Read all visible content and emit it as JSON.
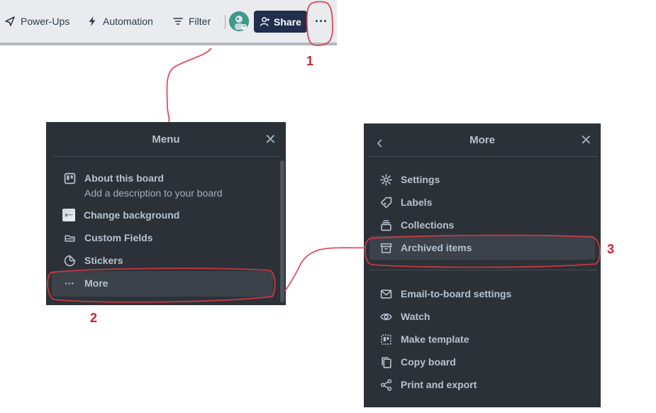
{
  "toolbar": {
    "power_ups": "Power-Ups",
    "automation": "Automation",
    "filter": "Filter",
    "share": "Share",
    "more": "···"
  },
  "menu_panel": {
    "title": "Menu",
    "close": "✕",
    "about": "About this board",
    "about_desc": "Add a description to your board",
    "change_background": "Change background",
    "background_thumb_text": "a—",
    "custom_fields": "Custom Fields",
    "stickers": "Stickers",
    "more": "More",
    "more_dots": "···"
  },
  "more_panel": {
    "title": "More",
    "back": "‹",
    "close": "✕",
    "items": [
      "Settings",
      "Labels",
      "Collections",
      "Archived items",
      "Email-to-board settings",
      "Watch",
      "Make template",
      "Copy board",
      "Print and export"
    ]
  },
  "annotations": {
    "step1": "1",
    "step2": "2",
    "step3": "3",
    "color": "#d02030"
  },
  "colors": {
    "panel_bg": "#2c3137",
    "panel_text": "#b6c2cf",
    "share_bg": "#1f2f4d"
  }
}
